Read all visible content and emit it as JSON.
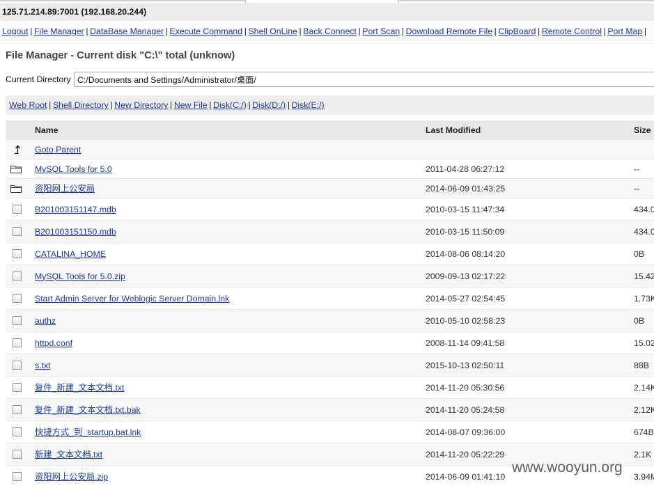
{
  "header": {
    "host": "125.71.214.89:7001 (192.168.20.244)"
  },
  "nav": {
    "separator": "|",
    "items": [
      "Logout",
      "File Manager",
      "DataBase Manager",
      "Execute Command",
      "Shell OnLine",
      "Back Connect",
      "Port Scan",
      "Download Remote File",
      "ClipBoard",
      "Remote Control",
      "Port Map"
    ]
  },
  "page_title": "File Manager - Current disk \"C:\\\" total (unknow)",
  "current_directory": {
    "label": "Current Directory",
    "value": "C:/Documents and Settings/Administrator/桌面/"
  },
  "quick_links": {
    "separator": "|",
    "items": [
      "Web Root",
      "Shell Directory",
      "New Directory",
      "New File",
      "Disk(C:/)",
      "Disk(D:/)",
      "Disk(E:/)"
    ]
  },
  "table": {
    "headers": {
      "name": "Name",
      "last_modified": "Last Modified",
      "size": "Size"
    },
    "parent": {
      "label": "Goto Parent",
      "icon": "arrow-up-icon"
    },
    "folders": [
      {
        "name": "MySQL Tools for 5.0",
        "modified": "2011-04-28 06:27:12",
        "size": "--",
        "icon": "folder-icon"
      },
      {
        "name": "资阳网上公安局",
        "modified": "2014-06-09 01:43:25",
        "size": "--",
        "icon": "folder-icon"
      }
    ],
    "files": [
      {
        "name": "B201003151147.mdb",
        "modified": "2010-03-15 11:47:34",
        "size": "434.0"
      },
      {
        "name": "B201003151150.mdb",
        "modified": "2010-03-15 11:50:09",
        "size": "434.0"
      },
      {
        "name": "CATALINA_HOME",
        "modified": "2014-08-06 08:14:20",
        "size": "0B"
      },
      {
        "name": "MySQL Tools for 5.0.zip",
        "modified": "2009-09-13 02:17:22",
        "size": "15.42"
      },
      {
        "name": "Start Admin Server for Weblogic Server Domain.lnk",
        "modified": "2014-05-27 02:54:45",
        "size": "1.73K"
      },
      {
        "name": "authz",
        "modified": "2010-05-10 02:58:23",
        "size": "0B"
      },
      {
        "name": "httpd.conf",
        "modified": "2008-11-14 09:41:58",
        "size": "15.02"
      },
      {
        "name": "s.txt",
        "modified": "2015-10-13 02:50:11",
        "size": "88B"
      },
      {
        "name": "复件_新建_文本文档.txt",
        "modified": "2014-11-20 05:30:56",
        "size": "2.14K"
      },
      {
        "name": "复件_新建_文本文档.txt.bak",
        "modified": "2014-11-20 05:24:58",
        "size": "2.12K"
      },
      {
        "name": "快捷方式_到_startup.bat.lnk",
        "modified": "2014-08-07 09:36:00",
        "size": "674B"
      },
      {
        "name": "新建_文本文档.txt",
        "modified": "2014-11-20 05:22:29",
        "size": "2.1K"
      },
      {
        "name": "资阳网上公安局.zip",
        "modified": "2014-06-09 01:41:10",
        "size": "3.94M"
      }
    ]
  },
  "watermark": "www.wooyun.org",
  "colors": {
    "link": "#1a3c8c",
    "host_bg": "#ececec",
    "bar_bg": "#eeeeee",
    "table_header_bg": "#e7e7e7"
  }
}
